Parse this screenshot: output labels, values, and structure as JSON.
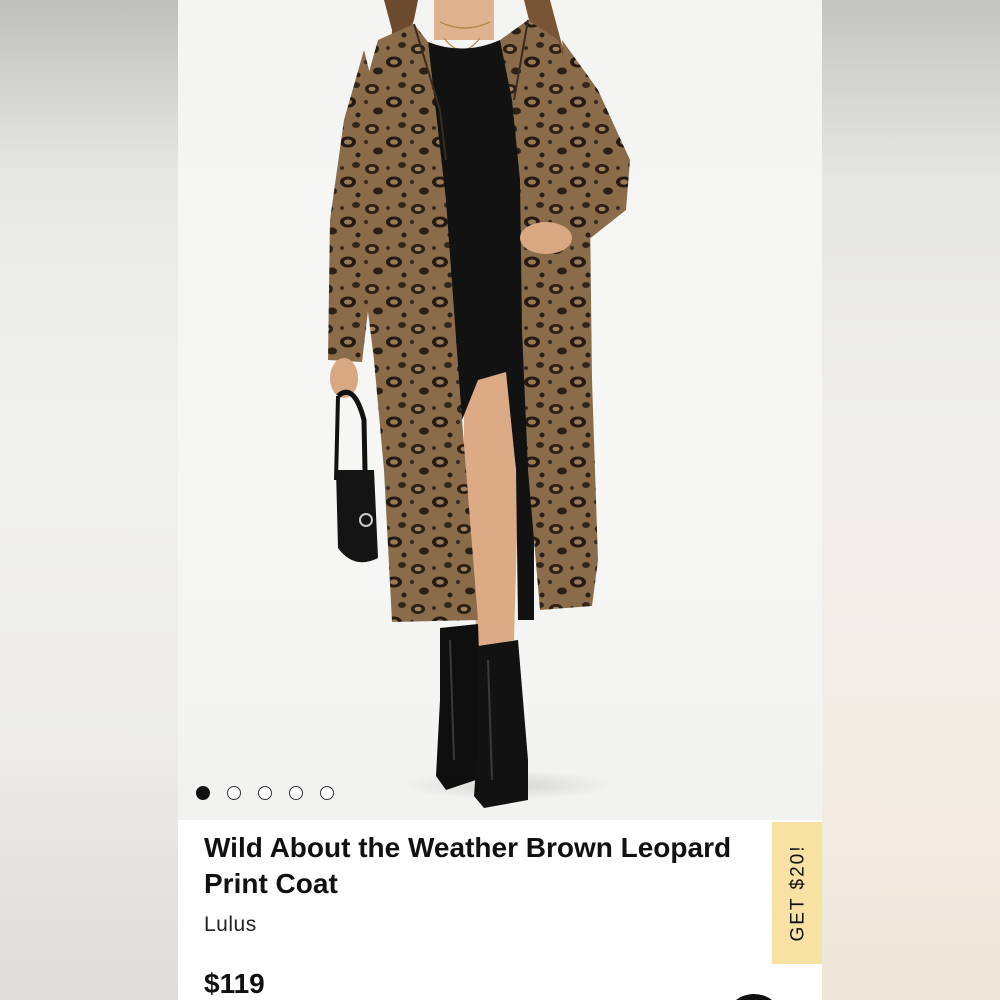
{
  "carousel": {
    "slide_count": 5,
    "active_index": 0
  },
  "product": {
    "title_line1": "Wild About the Weather Brown Leopard",
    "title_line2": "Print Coat",
    "brand": "Lulus",
    "price": "$119"
  },
  "promo": {
    "label": "GET $20!"
  },
  "colors": {
    "promo_background": "#f7e2a3",
    "text_primary": "#111111"
  },
  "icons": {
    "carousel_dot": "circle",
    "corner_widget": "chat-bubble"
  }
}
